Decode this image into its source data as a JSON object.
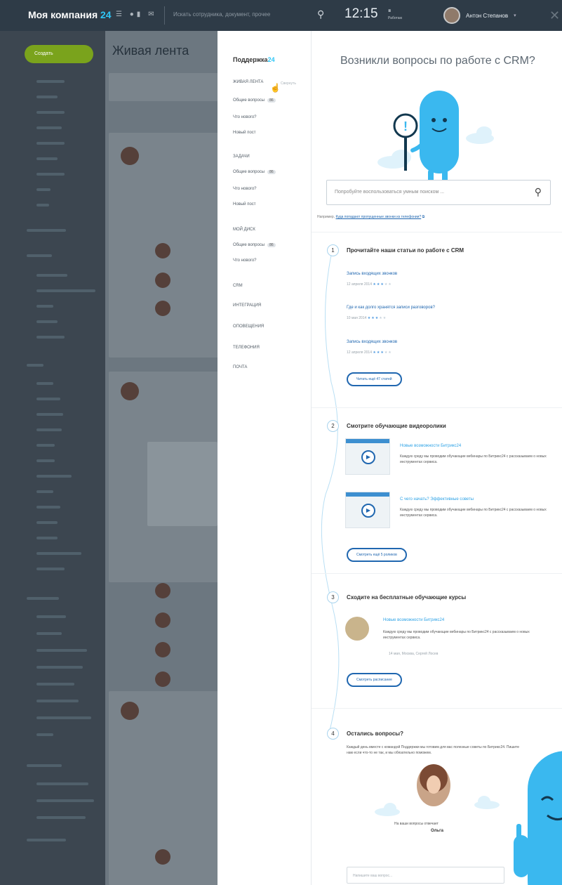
{
  "app": {
    "company_name": "Моя компания",
    "company_number": "24",
    "search_placeholder": "Искать сотрудника, документ, прочее",
    "clock": "12:15",
    "clock_status": "Работаю",
    "user_name": "Антон Степанов"
  },
  "feed": {
    "create_button": "Создать",
    "title": "Живая лента"
  },
  "support_menu": {
    "brand": "Поддержка",
    "brand_number": "24",
    "items": [
      {
        "label": "Живая лента",
        "type": "section"
      },
      {
        "label": "Общие вопросы",
        "badge": "86",
        "type": "item"
      },
      {
        "label": "Что нового?",
        "type": "item"
      },
      {
        "label": "Новый пост",
        "type": "item"
      },
      {
        "label": "Задачи",
        "type": "section"
      },
      {
        "label": "Общие вопросы",
        "badge": "86",
        "type": "item"
      },
      {
        "label": "Что нового?",
        "type": "item"
      },
      {
        "label": "Новый пост",
        "type": "item"
      },
      {
        "label": "Мой диск",
        "type": "section"
      },
      {
        "label": "Общие вопросы",
        "badge": "86",
        "type": "item"
      },
      {
        "label": "Что нового?",
        "type": "item"
      },
      {
        "label": "CRM",
        "type": "section"
      },
      {
        "label": "Интеграция",
        "type": "section"
      },
      {
        "label": "Оповещения",
        "type": "section"
      },
      {
        "label": "Телефония",
        "type": "section"
      },
      {
        "label": "Почта",
        "type": "section"
      }
    ],
    "hint": "Свернуть"
  },
  "panel": {
    "title": "Возникли вопросы по работе с CRM?",
    "search_placeholder": "Попробуйте воспользоваться умным поиском ...",
    "search_hint_prefix": "Например,",
    "search_hint_link": "Куда попадают пропущенные звонки из телефонии?",
    "steps": [
      {
        "number": "1",
        "title": "Прочитайте наши статьи по работе с CRM",
        "articles": [
          {
            "title": "Запись входящих звонков",
            "date": "12 апреля 2014",
            "rating": 3
          },
          {
            "title": "Где и как долго хранятся записи разговоров?",
            "date": "10 мая 2014",
            "rating": 3
          },
          {
            "title": "Запись входящих звонков",
            "date": "12 апреля 2014",
            "rating": 3
          }
        ],
        "button": "Читать ещё 47 статей"
      },
      {
        "number": "2",
        "title": "Смотрите обучающие видеоролики",
        "videos": [
          {
            "title": "Новые возможности Битрикс24",
            "description": "Каждую среду мы проводим обучающие вебинары по Битрикс24 с рассказываем о новых инструментах сервиса."
          },
          {
            "title": "С чего начать? Эффективные советы",
            "description": "Каждую среду мы проводим обучающие вебинары по Битрикс24 с рассказываем о новых инструментах сервиса."
          }
        ],
        "button": "Смотреть ещё 5 роликов"
      },
      {
        "number": "3",
        "title": "Сходите на бесплатные обучающие курсы",
        "course": {
          "title": "Новые возможности Битрикс24",
          "description": "Каждую среду мы проводим обучающие вебинары по Битрикс24 с рассказываем о новых инструментах сервиса.",
          "meta": "14 мая, Москва, Сергей Лосев"
        },
        "button": "Смотреть расписание"
      },
      {
        "number": "4",
        "title": "Остались вопросы?",
        "description": "Каждый день вместе с командой Поддержки мы готовим для вас полезные советы по Битрикс24. Пишите нам если что-то не так, и мы обязательно поможем.",
        "operator_caption": "На ваши вопросы отвечает",
        "operator_name": "Ольга",
        "ask_placeholder": "Напишите ваш вопрос..."
      }
    ]
  },
  "colors": {
    "topbar": "#2e3b47",
    "accent": "#2fc6f6",
    "link": "#2067b0",
    "mascot": "#3ab8ef"
  }
}
